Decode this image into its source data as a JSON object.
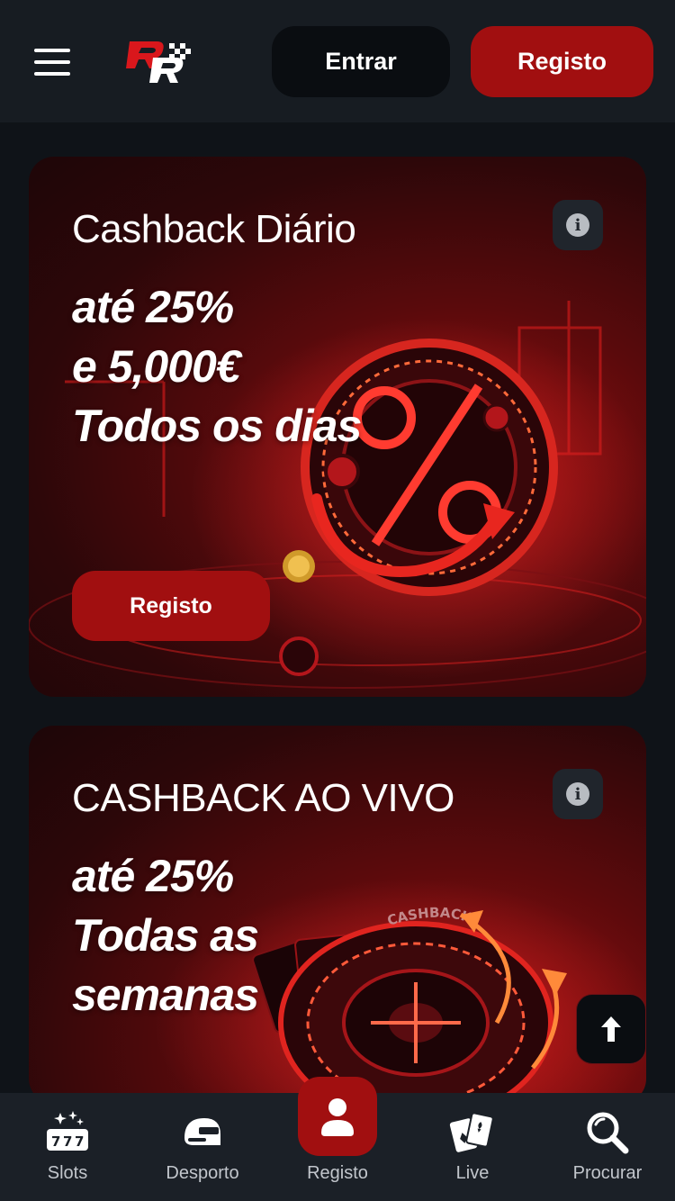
{
  "header": {
    "menu_icon": "hamburger-menu-icon",
    "logo_icon": "racing-RR-logo",
    "login_label": "Entrar",
    "register_label": "Registo"
  },
  "promos": [
    {
      "title": "Cashback Diário",
      "headline": [
        "até 25%",
        "e 5,000€",
        "Todos os dias"
      ],
      "cta_label": "Registo",
      "info_icon": "info-icon"
    },
    {
      "title": "CASHBACK AO VIVO",
      "headline": [
        "até 25%",
        "Todas as",
        "semanas"
      ],
      "art_text": "CASHBACK",
      "info_icon": "info-icon"
    }
  ],
  "back_to_top_icon": "arrow-up-icon",
  "bottom_nav": [
    {
      "label": "Slots",
      "icon": "slot-machine-icon"
    },
    {
      "label": "Desporto",
      "icon": "helmet-icon"
    },
    {
      "label": "Registo",
      "icon": "user-icon"
    },
    {
      "label": "Live",
      "icon": "cards-icon"
    },
    {
      "label": "Procurar",
      "icon": "search-icon"
    }
  ],
  "colors": {
    "brand_red": "#a10f10",
    "header_bg": "#171c22",
    "page_bg": "#0f1318",
    "nav_bg": "#1b2027"
  }
}
